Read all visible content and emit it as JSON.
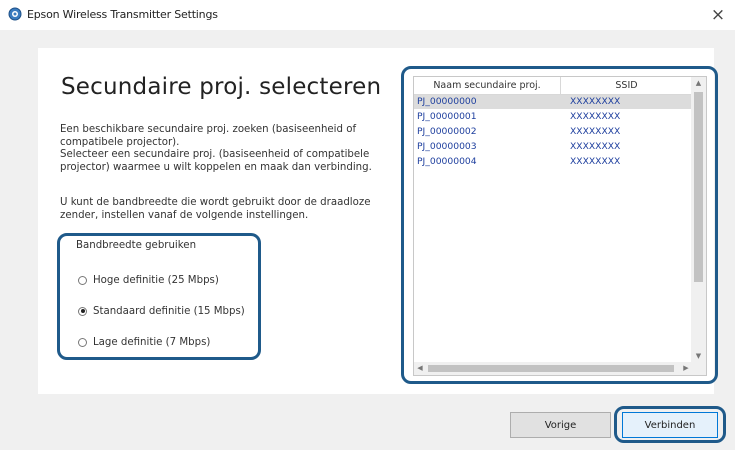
{
  "window": {
    "title": "Epson Wireless Transmitter Settings",
    "close_glyph": "×",
    "icon": "epson-app-icon"
  },
  "main": {
    "heading": "Secundaire proj. selecteren",
    "description1": "Een beschikbare secundaire proj. zoeken (basiseenheid of compatibele projector).\nSelecteer een secundaire proj. (basiseenheid of compatibele projector) waarmee u wilt koppelen en maak dan verbinding.",
    "description2": "U kunt de bandbreedte die wordt gebruikt door de draadloze zender, instellen vanaf de volgende instellingen."
  },
  "bandwidth": {
    "label": "Bandbreedte gebruiken",
    "options": [
      {
        "label": "Hoge definitie (25 Mbps)",
        "checked": false
      },
      {
        "label": "Standaard definitie (15 Mbps)",
        "checked": true
      },
      {
        "label": "Lage definitie (7 Mbps)",
        "checked": false
      }
    ]
  },
  "projector_list": {
    "columns": [
      "Naam secundaire proj.",
      "SSID"
    ],
    "rows": [
      {
        "name": "PJ_00000000",
        "ssid": "XXXXXXXX",
        "selected": true
      },
      {
        "name": "PJ_00000001",
        "ssid": "XXXXXXXX",
        "selected": false
      },
      {
        "name": "PJ_00000002",
        "ssid": "XXXXXXXX",
        "selected": false
      },
      {
        "name": "PJ_00000003",
        "ssid": "XXXXXXXX",
        "selected": false
      },
      {
        "name": "PJ_00000004",
        "ssid": "XXXXXXXX",
        "selected": false
      }
    ]
  },
  "buttons": {
    "previous": "Vorige",
    "connect": "Verbinden"
  },
  "colors": {
    "highlight_outline": "#1f5a8a",
    "row_text": "#1e3f9e",
    "selected_row": "#dcdcdc"
  }
}
